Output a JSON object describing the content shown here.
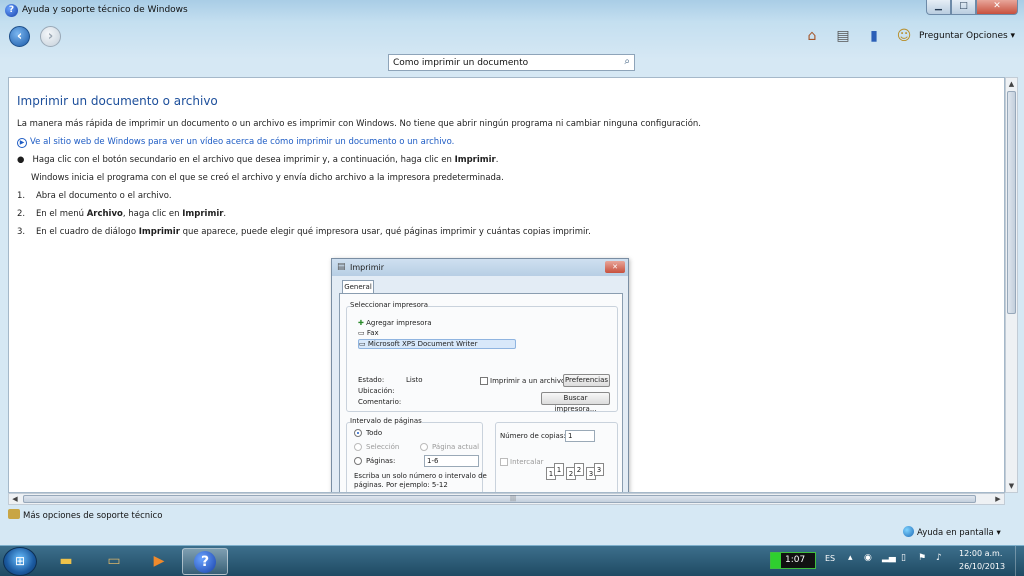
{
  "window": {
    "title": "Ayuda y soporte técnico de Windows",
    "minimize": "▁",
    "maximize": "□",
    "close": "✕"
  },
  "toolbar": {
    "preguntar": "Preguntar",
    "opciones": "Opciones ▾"
  },
  "search": {
    "value": "Como imprimir un documento"
  },
  "article": {
    "title": "Imprimir un documento o archivo",
    "intro": "La manera más rápida de imprimir un documento o un archivo es imprimir con Windows. No tiene que abrir ningún programa ni cambiar ninguna configuración.",
    "video_link": "Ve al sitio web de Windows para ver un vídeo acerca de cómo imprimir un documento o un archivo.",
    "bullet_pre": "Haga clic con el botón secundario en el archivo que desea imprimir y, a continuación, haga clic en ",
    "bullet_bold": "Imprimir",
    "bullet_post": ".",
    "bullet_note": "Windows inicia el programa con el que se creó el archivo y envía dicho archivo a la impresora predeterminada.",
    "step1_num": "1.",
    "step1": "Abra el documento o el archivo.",
    "step2_num": "2.",
    "step2_pre": "En el menú ",
    "step2_bold1": "Archivo",
    "step2_mid": ", haga clic en ",
    "step2_bold2": "Imprimir",
    "step2_post": ".",
    "step3_num": "3.",
    "step3_pre": "En el cuadro de diálogo ",
    "step3_bold": "Imprimir",
    "step3_post": " que aparece, puede elegir qué impresora usar, qué páginas imprimir y cuántas copias imprimir."
  },
  "dialog": {
    "title": "Imprimir",
    "tab": "General",
    "select_printer": "Seleccionar impresora",
    "printers": [
      "Agregar impresora",
      "Fax",
      "Microsoft XPS Document Writer"
    ],
    "estado_label": "Estado:",
    "estado_value": "Listo",
    "ubicacion_label": "Ubicación:",
    "comentario_label": "Comentario:",
    "print_to_file": "Imprimir a un archivo",
    "preferences": "Preferencias",
    "find_printer": "Buscar impresora...",
    "page_range": "Intervalo de páginas",
    "all": "Todo",
    "selection": "Selección",
    "current_page": "Página actual",
    "pages": "Páginas:",
    "pages_value": "1-6",
    "hint_line1": "Escriba un solo número o intervalo de",
    "hint_line2": "páginas. Por ejemplo: 5-12",
    "copies_label": "Número de copias:",
    "copies_value": "1",
    "collate": "Intercalar",
    "collate_pages": [
      "1",
      "1",
      "2",
      "2",
      "3",
      "3"
    ]
  },
  "footer": {
    "more_options": "Más opciones de soporte técnico",
    "online_help": "Ayuda en pantalla ▾"
  },
  "taskbar": {
    "timer": "1:07",
    "language": "ES",
    "time": "12:00 a.m.",
    "date": "26/10/2013"
  },
  "icons": {
    "start": "start-orb-icon",
    "explorer": "folder-icon",
    "ie": "browser-icon",
    "media": "media-player-icon",
    "help": "help-icon"
  },
  "colors": {
    "link": "#1e5cc4",
    "heading": "#1d4f9b"
  }
}
